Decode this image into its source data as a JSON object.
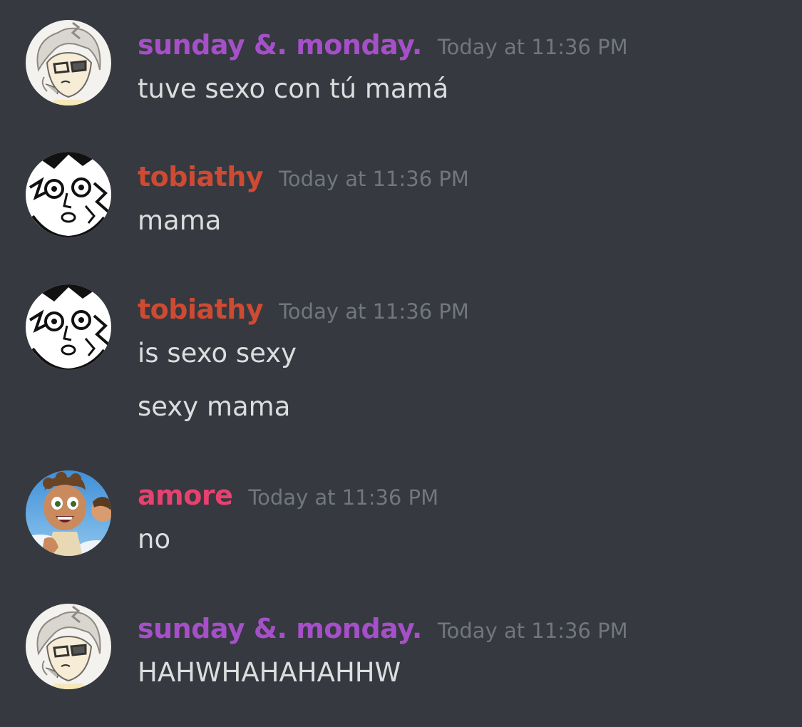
{
  "messages": [
    {
      "username": "sunday &. monday.",
      "color": "#a550c8",
      "avatar": "sketch-avatar-icon",
      "timestamp": "Today at 11:36 PM",
      "lines": [
        "tuve sexo con tú mamá"
      ]
    },
    {
      "username": "tobiathy",
      "color": "#cf4a32",
      "avatar": "manga-avatar-icon",
      "timestamp": "Today at 11:36 PM",
      "lines": [
        "mama"
      ]
    },
    {
      "username": "tobiathy",
      "color": "#cf4a32",
      "avatar": "manga-avatar-icon",
      "timestamp": "Today at 11:36 PM",
      "lines": [
        "is sexo sexy",
        "sexy mama"
      ]
    },
    {
      "username": "amore",
      "color": "#e8416f",
      "avatar": "cartoon-avatar-icon",
      "timestamp": "Today at 11:36 PM",
      "lines": [
        "no"
      ]
    },
    {
      "username": "sunday &. monday.",
      "color": "#a550c8",
      "avatar": "sketch-avatar-icon",
      "timestamp": "Today at 11:36 PM",
      "lines": [
        "HAHWHAHAHAHHW"
      ]
    }
  ]
}
